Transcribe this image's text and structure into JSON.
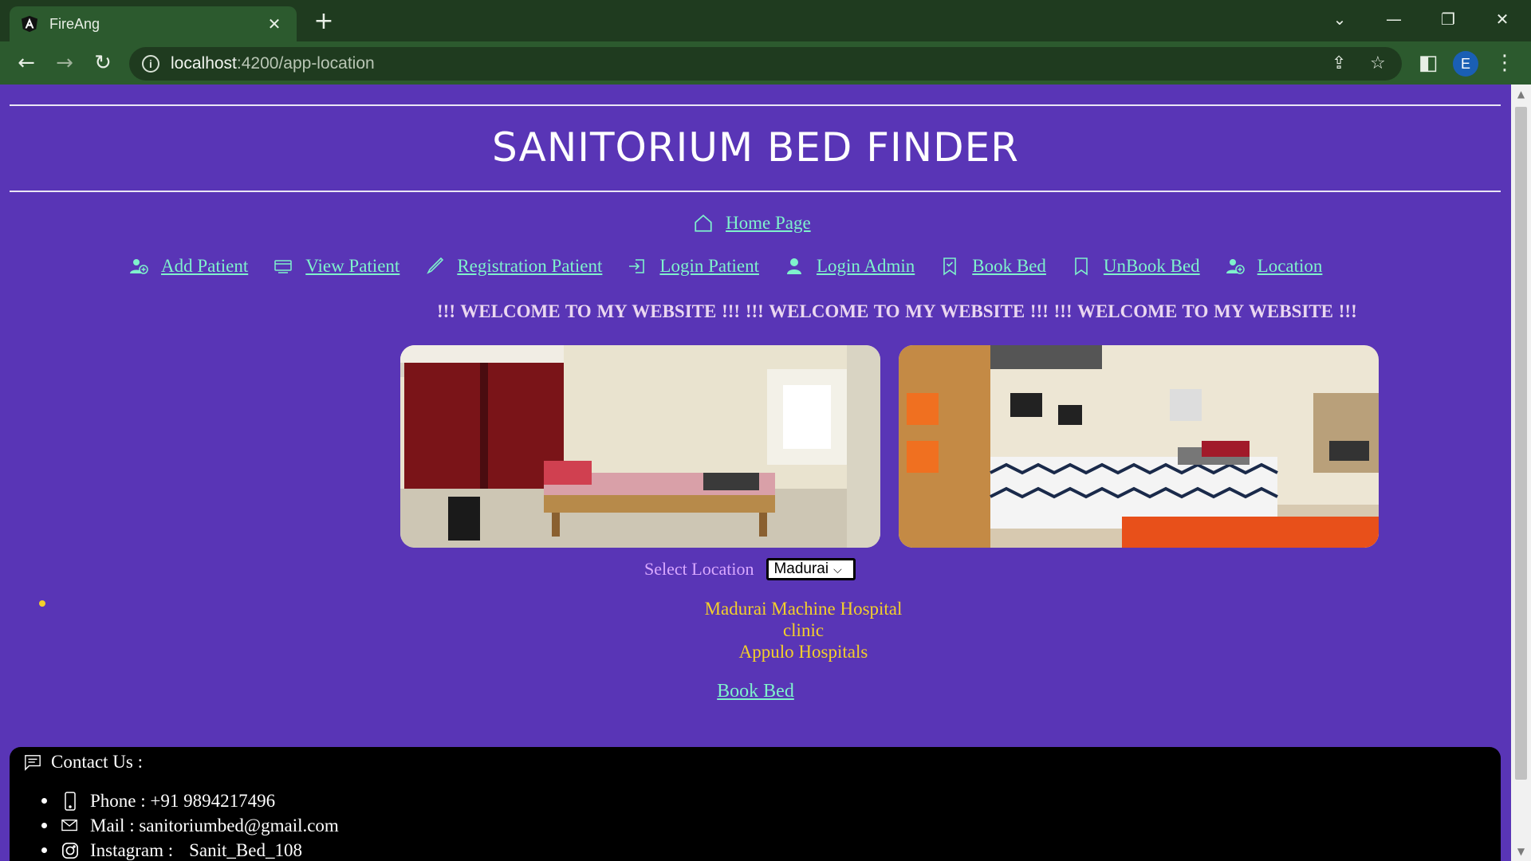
{
  "browser": {
    "tab_title": "FireAng",
    "tab_close": "✕",
    "new_tab": "+",
    "url_host": "localhost",
    "url_path": ":4200/app-location",
    "profile_initial": "E",
    "icons": [
      "angular-icon",
      "back-icon",
      "forward-icon",
      "reload-icon",
      "info-icon",
      "share-icon",
      "star-icon",
      "side-panel-icon",
      "kebab-menu-icon",
      "minimize-icon",
      "restore-icon",
      "close-window-icon",
      "tab-search-icon"
    ]
  },
  "header": {
    "title": "SANITORIUM BED FINDER",
    "home_link": "Home Page"
  },
  "nav": {
    "items": [
      {
        "label": "Add Patient",
        "icon": "person-add-icon"
      },
      {
        "label": "View Patient",
        "icon": "window-icon"
      },
      {
        "label": "Registration Patient",
        "icon": "pencil-icon"
      },
      {
        "label": "Login Patient",
        "icon": "login-icon"
      },
      {
        "label": "Login Admin",
        "icon": "person-icon"
      },
      {
        "label": "Book Bed",
        "icon": "bookmark-check-icon"
      },
      {
        "label": "UnBook Bed",
        "icon": "bookmark-icon"
      },
      {
        "label": "Location",
        "icon": "person-add-icon"
      }
    ]
  },
  "marquee_text": "!!! WELCOME TO MY WEBSITE !!!   !!! WELCOME TO MY WEBSITE !!!  !!! WELCOME TO MY WEBSITE !!!",
  "location": {
    "label": "Select Location",
    "selected": "Madurai"
  },
  "hospitals": [
    "Madurai Machine Hospital",
    "clinic",
    "Appulo Hospitals"
  ],
  "book_bed_link": "Book Bed",
  "footer": {
    "heading": "Contact Us :",
    "phone": "Phone : +91 9894217496",
    "mail": "Mail : sanitoriumbed@gmail.com",
    "instagram_label": "Instagram :",
    "instagram_handle": "Sanit_Bed_108"
  },
  "colors": {
    "page_bg": "#5935b6",
    "link": "#7ff2cc",
    "hospital_text": "#f3cf2a",
    "footer_bg": "#000000",
    "browser_toolbar": "#2c5a2e"
  }
}
